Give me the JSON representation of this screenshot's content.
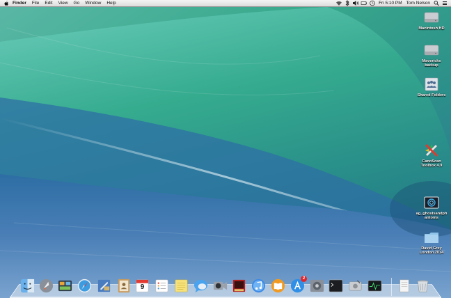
{
  "menubar": {
    "app_name": "Finder",
    "menus": [
      "File",
      "Edit",
      "View",
      "Go",
      "Window",
      "Help"
    ],
    "clock": "Fri 5:10 PM",
    "user": "Tom Nelson"
  },
  "desktop_icons": [
    {
      "label": "Macintosh HD",
      "icon": "hard-drive-icon"
    },
    {
      "label": "Mavericks backup",
      "icon": "hard-drive-icon"
    },
    {
      "label": "Shared Folders",
      "icon": "shared-folder-icon"
    },
    {
      "label": "CanoScan Toolbox 4.9",
      "icon": "canoscan-app-icon"
    },
    {
      "label": "ag_ghostsandph antoms",
      "icon": "image-file-icon"
    },
    {
      "label": "David Grey London 2014",
      "icon": "folder-icon"
    }
  ],
  "dock": {
    "apps": [
      "Finder",
      "Launchpad",
      "Mission Control",
      "Safari",
      "Mail",
      "Contacts",
      "Calendar",
      "Reminders",
      "Notes",
      "Messages",
      "FaceTime",
      "Photo Booth",
      "iTunes",
      "iBooks",
      "App Store",
      "System Preferences",
      "Terminal",
      "Disk Utility",
      "Activity Monitor"
    ],
    "calendar_day": "9",
    "app_store_badge": "2",
    "trailing": [
      "Documents",
      "Trash"
    ]
  },
  "colors": {
    "menubar": "#e6e6e6",
    "wave_green": "#3fae8b",
    "wave_blue": "#3a6ea8",
    "badge": "#e0262b"
  }
}
